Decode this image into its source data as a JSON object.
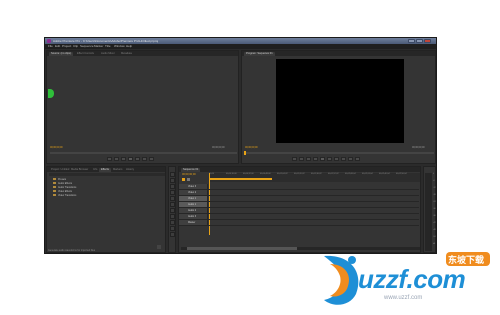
{
  "window": {
    "title": "Adobe Premiere Pro - C:\\Users\\Documents\\Adobe\\Premiere Pro\\Untitled.prproj",
    "controls": [
      "minimize",
      "maximize",
      "close"
    ]
  },
  "menu": {
    "items": [
      "File",
      "Edit",
      "Project",
      "Clip",
      "Sequence",
      "Marker",
      "Title",
      "Window",
      "Help"
    ]
  },
  "source_panel": {
    "tabs": [
      "Source: (no clips)",
      "Effect Controls",
      "Audio Mixer",
      "Metadata"
    ],
    "timecode_left": "00;00;00;00",
    "timecode_right": "00;00;00;00"
  },
  "program_panel": {
    "tab": "Program: Sequence 01",
    "timecode_left": "00;00;00;00",
    "timecode_right": "00;00;00;00"
  },
  "project_panel": {
    "tabs": [
      "Project: Untitled",
      "Media Browser",
      "Info",
      "Effects",
      "Markers",
      "History"
    ],
    "items": [
      "Presets",
      "Audio Effects",
      "Audio Transitions",
      "Video Effects",
      "Video Transitions"
    ],
    "status": "Generate audio waveforms for imported files"
  },
  "timeline_panel": {
    "tab": "Sequence 01",
    "timecode": "00;00;00;00",
    "ruler_labels": [
      "00;00",
      "00;00;16;00",
      "00;00;32;00",
      "00;00;48;00",
      "00;01;04;02",
      "00;01;20;02",
      "00;01;36;02",
      "00;01;52;02",
      "00;02;08;04",
      "00;02;24;04",
      "00;02;40;04",
      "00;02;56;04"
    ],
    "tracks": [
      "Video 3",
      "Video 2",
      "Video 1",
      "Audio 1",
      "Audio 2",
      "Audio 3",
      "Master"
    ]
  },
  "audio_meters": {
    "scale": [
      "0",
      "-6",
      "-12",
      "-18",
      "-24",
      "-30",
      "-36",
      "-42",
      "-48",
      "-54",
      "dB"
    ]
  },
  "watermark": {
    "brand": "uzzf.com",
    "badge": "东坡下载",
    "url": "www.uzzf.com"
  },
  "colors": {
    "accent": "#e8a317",
    "panel_bg": "#343434",
    "app_bg": "#2b2b2b",
    "title_bar": "#5b6a88",
    "watermark_blue": "#1e8fd6",
    "watermark_orange": "#f08c1e"
  }
}
